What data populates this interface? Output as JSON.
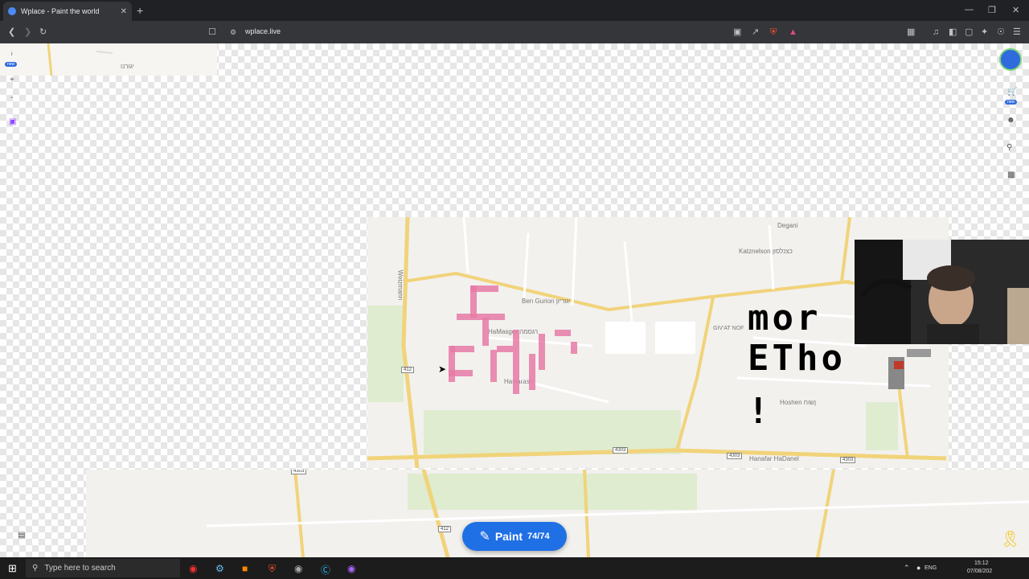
{
  "browser": {
    "tab_title": "Wplace - Paint the world",
    "new_tab": "+",
    "tab_close": "✕",
    "url": "wplace.live",
    "min": "—",
    "max": "❐",
    "close": "✕"
  },
  "map": {
    "labels": {
      "ben_gurion": "Ben Gurion יגוריון",
      "katznelson": "Katznelson כצנלסון",
      "degania": "Degani",
      "givat_nof": "GIV'AT NOF",
      "hashen": "Hoshen ןשוח",
      "hanafar": "Hanafar HaDanel",
      "hamasger": "HaMasger רגסמה",
      "haharash": "HaHarash",
      "weizmann": "Weizmann",
      "road_412a": "412",
      "road_412b": "412",
      "road_4303a": "4303",
      "road_4303b": "4303",
      "road_4303c": "4303",
      "top_label": "יגורנו"
    }
  },
  "overlay_text": {
    "line1": "mor",
    "line2": "ETho",
    "line3": "!"
  },
  "left_bar": {
    "info": "i",
    "new_badge": "new",
    "zoom_in": "+",
    "zoom_out": "-"
  },
  "right_bar": {
    "new_badge": "new"
  },
  "paint_button": {
    "icon": "✎",
    "label": "Paint",
    "count": "74/74"
  },
  "taskbar": {
    "search_placeholder": "Type here to search",
    "lang": "ENG",
    "time": "15:12",
    "date": "07/08/202"
  },
  "colors": {
    "accent": "#1f6fe5",
    "pixel_pink": "#e87aa6"
  }
}
